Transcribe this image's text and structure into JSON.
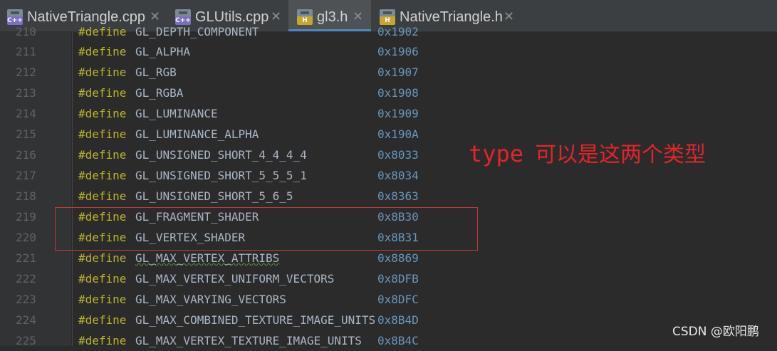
{
  "tabs": [
    {
      "label": "NativeTriangle.cpp",
      "icon": "cpp-file-icon",
      "icon_text": "C++",
      "active": false
    },
    {
      "label": "GLUtils.cpp",
      "icon": "cpp-file-icon",
      "icon_text": "C++",
      "active": false
    },
    {
      "label": "gl3.h",
      "icon": "header-file-icon",
      "icon_text": "H",
      "active": true
    },
    {
      "label": "NativeTriangle.h",
      "icon": "header-file-icon",
      "icon_text": "H",
      "active": false
    }
  ],
  "close_glyph": "✕",
  "code": {
    "keyword": "#define",
    "lines": [
      {
        "num": "210",
        "name": "GL_DEPTH_COMPONENT",
        "value": "0x1902"
      },
      {
        "num": "211",
        "name": "GL_ALPHA",
        "value": "0x1906"
      },
      {
        "num": "212",
        "name": "GL_RGB",
        "value": "0x1907"
      },
      {
        "num": "213",
        "name": "GL_RGBA",
        "value": "0x1908"
      },
      {
        "num": "214",
        "name": "GL_LUMINANCE",
        "value": "0x1909"
      },
      {
        "num": "215",
        "name": "GL_LUMINANCE_ALPHA",
        "value": "0x190A"
      },
      {
        "num": "216",
        "name": "GL_UNSIGNED_SHORT_4_4_4_4",
        "value": "0x8033"
      },
      {
        "num": "217",
        "name": "GL_UNSIGNED_SHORT_5_5_5_1",
        "value": "0x8034"
      },
      {
        "num": "218",
        "name": "GL_UNSIGNED_SHORT_5_6_5",
        "value": "0x8363"
      },
      {
        "num": "219",
        "name": "GL_FRAGMENT_SHADER",
        "value": "0x8B30"
      },
      {
        "num": "220",
        "name": "GL_VERTEX_SHADER",
        "value": "0x8B31"
      },
      {
        "num": "221",
        "name": "GL_MAX_VERTEX_ATTRIBS",
        "value": "0x8869"
      },
      {
        "num": "222",
        "name": "GL_MAX_VERTEX_UNIFORM_VECTORS",
        "value": "0x8DFB"
      },
      {
        "num": "223",
        "name": "GL_MAX_VARYING_VECTORS",
        "value": "0x8DFC"
      },
      {
        "num": "224",
        "name": "GL_MAX_COMBINED_TEXTURE_IMAGE_UNITS",
        "value": "0x8B4D"
      },
      {
        "num": "225",
        "name": "GL_MAX_VERTEX_TEXTURE_IMAGE_UNITS",
        "value": "0x8B4C"
      }
    ]
  },
  "annotation": {
    "code_word": "type",
    "text": "可以是这两个类型",
    "color": "#e0252a"
  },
  "watermark": "CSDN @欧阳鹏",
  "colors": {
    "keyword": "#bbb529",
    "identifier": "#a9b7c6",
    "number": "#6897bb",
    "line_number": "#606366",
    "highlight_box": "#c23a3a",
    "active_tab_underline": "#4a88c7"
  }
}
